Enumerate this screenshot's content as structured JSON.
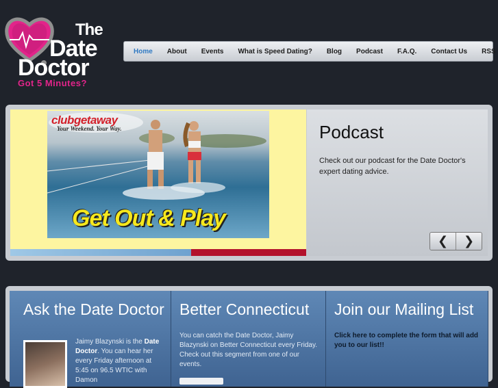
{
  "logo": {
    "line1": "The",
    "line2": "Date",
    "line3": "Doctor",
    "tagline": "Got 5 Minutes?"
  },
  "nav": {
    "items": [
      {
        "label": "Home",
        "active": true
      },
      {
        "label": "About"
      },
      {
        "label": "Events"
      },
      {
        "label": "What is Speed Dating?"
      },
      {
        "label": "Blog"
      },
      {
        "label": "Podcast"
      },
      {
        "label": "F.A.Q."
      },
      {
        "label": "Contact Us"
      },
      {
        "label": "RSS"
      }
    ]
  },
  "slider": {
    "ad_brand": "clubgetaway",
    "ad_sub": "Your Weekend. Your Way.",
    "ad_cta": "Get Out & Play",
    "title": "Podcast",
    "text": "Check out our podcast for the Date Doctor's expert dating advice."
  },
  "ask": {
    "title": "Ask the Date Doctor",
    "bio_prefix": "Jaimy Blazynski is the ",
    "bio_bold": "Date Doctor",
    "bio_suffix": ". You can hear her every Friday afternoon at 5:45 on 96.5 WTIC with Damon"
  },
  "connecticut": {
    "title": "Better Connecticut",
    "text": "You can catch the Date Doctor, Jaimy Blazynski on Better Connecticut every Friday. Check out this segment from one of our events."
  },
  "mailing": {
    "title": "Join our Mailing List",
    "link": "Click here to complete the form that will add you to our list!!"
  },
  "colors": {
    "accent": "#e2248a",
    "nav_active": "#2f79c2",
    "background": "#1f232b",
    "panel_blue": "#4f76a4"
  }
}
